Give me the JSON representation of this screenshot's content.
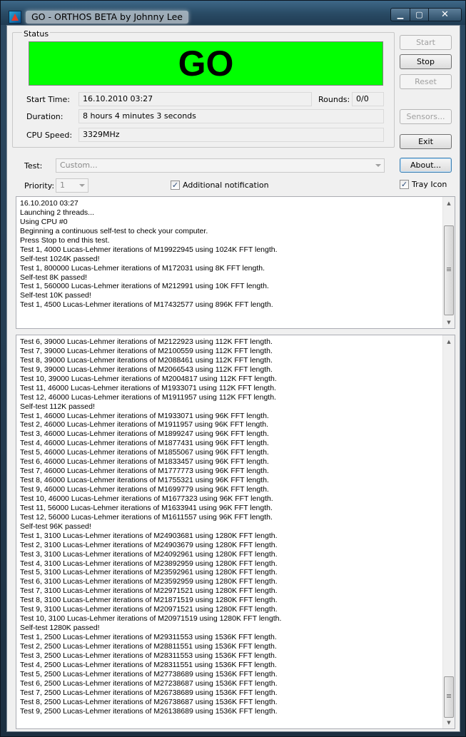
{
  "window": {
    "title": "GO - ORTHOS BETA by Johnny Lee",
    "minimize_glyph": "▁",
    "maximize_glyph": "▢",
    "close_glyph": "✕"
  },
  "status": {
    "legend": "Status",
    "state_text": "GO",
    "state_color": "#00ff00",
    "start_time_label": "Start Time:",
    "start_time_value": "16.10.2010 03:27",
    "rounds_label": "Rounds:",
    "rounds_value": "0/0",
    "duration_label": "Duration:",
    "duration_value": "8 hours 4 minutes 3 seconds",
    "cpu_speed_label": "CPU Speed:",
    "cpu_speed_value": "3329MHz"
  },
  "buttons": {
    "start": "Start",
    "stop": "Stop",
    "reset": "Reset",
    "sensors": "Sensors...",
    "exit": "Exit",
    "about": "About..."
  },
  "options": {
    "test_label": "Test:",
    "test_value": "Custom...",
    "priority_label": "Priority:",
    "priority_value": "1",
    "additional_notification_label": "Additional notification",
    "additional_notification_checked": true,
    "tray_icon_label": "Tray Icon",
    "tray_icon_checked": true,
    "check_glyph": "✓"
  },
  "log_top": {
    "lines": [
      "16.10.2010 03:27",
      "Launching 2 threads...",
      "Using CPU #0",
      "Beginning a continuous self-test to check your computer.",
      "Press Stop to end this test.",
      "Test 1, 4000 Lucas-Lehmer iterations of M19922945 using 1024K FFT length.",
      "Self-test 1024K passed!",
      "Test 1, 800000 Lucas-Lehmer iterations of M172031 using 8K FFT length.",
      "Self-test 8K passed!",
      "Test 1, 560000 Lucas-Lehmer iterations of M212991 using 10K FFT length.",
      "Self-test 10K passed!",
      "Test 1, 4500 Lucas-Lehmer iterations of M17432577 using 896K FFT length."
    ]
  },
  "log_bottom": {
    "lines": [
      "Test 6, 39000 Lucas-Lehmer iterations of M2122923 using 112K FFT length.",
      "Test 7, 39000 Lucas-Lehmer iterations of M2100559 using 112K FFT length.",
      "Test 8, 39000 Lucas-Lehmer iterations of M2088461 using 112K FFT length.",
      "Test 9, 39000 Lucas-Lehmer iterations of M2066543 using 112K FFT length.",
      "Test 10, 39000 Lucas-Lehmer iterations of M2004817 using 112K FFT length.",
      "Test 11, 46000 Lucas-Lehmer iterations of M1933071 using 112K FFT length.",
      "Test 12, 46000 Lucas-Lehmer iterations of M1911957 using 112K FFT length.",
      "Self-test 112K passed!",
      "Test 1, 46000 Lucas-Lehmer iterations of M1933071 using 96K FFT length.",
      "Test 2, 46000 Lucas-Lehmer iterations of M1911957 using 96K FFT length.",
      "Test 3, 46000 Lucas-Lehmer iterations of M1899247 using 96K FFT length.",
      "Test 4, 46000 Lucas-Lehmer iterations of M1877431 using 96K FFT length.",
      "Test 5, 46000 Lucas-Lehmer iterations of M1855067 using 96K FFT length.",
      "Test 6, 46000 Lucas-Lehmer iterations of M1833457 using 96K FFT length.",
      "Test 7, 46000 Lucas-Lehmer iterations of M1777773 using 96K FFT length.",
      "Test 8, 46000 Lucas-Lehmer iterations of M1755321 using 96K FFT length.",
      "Test 9, 46000 Lucas-Lehmer iterations of M1699779 using 96K FFT length.",
      "Test 10, 46000 Lucas-Lehmer iterations of M1677323 using 96K FFT length.",
      "Test 11, 56000 Lucas-Lehmer iterations of M1633941 using 96K FFT length.",
      "Test 12, 56000 Lucas-Lehmer iterations of M1611557 using 96K FFT length.",
      "Self-test 96K passed!",
      "Test 1, 3100 Lucas-Lehmer iterations of M24903681 using 1280K FFT length.",
      "Test 2, 3100 Lucas-Lehmer iterations of M24903679 using 1280K FFT length.",
      "Test 3, 3100 Lucas-Lehmer iterations of M24092961 using 1280K FFT length.",
      "Test 4, 3100 Lucas-Lehmer iterations of M23892959 using 1280K FFT length.",
      "Test 5, 3100 Lucas-Lehmer iterations of M23592961 using 1280K FFT length.",
      "Test 6, 3100 Lucas-Lehmer iterations of M23592959 using 1280K FFT length.",
      "Test 7, 3100 Lucas-Lehmer iterations of M22971521 using 1280K FFT length.",
      "Test 8, 3100 Lucas-Lehmer iterations of M21871519 using 1280K FFT length.",
      "Test 9, 3100 Lucas-Lehmer iterations of M20971521 using 1280K FFT length.",
      "Test 10, 3100 Lucas-Lehmer iterations of M20971519 using 1280K FFT length.",
      "Self-test 1280K passed!",
      "Test 1, 2500 Lucas-Lehmer iterations of M29311553 using 1536K FFT length.",
      "Test 2, 2500 Lucas-Lehmer iterations of M28811551 using 1536K FFT length.",
      "Test 3, 2500 Lucas-Lehmer iterations of M28311553 using 1536K FFT length.",
      "Test 4, 2500 Lucas-Lehmer iterations of M28311551 using 1536K FFT length.",
      "Test 5, 2500 Lucas-Lehmer iterations of M27738689 using 1536K FFT length.",
      "Test 6, 2500 Lucas-Lehmer iterations of M27238687 using 1536K FFT length.",
      "Test 7, 2500 Lucas-Lehmer iterations of M26738689 using 1536K FFT length.",
      "Test 8, 2500 Lucas-Lehmer iterations of M26738687 using 1536K FFT length.",
      "Test 9, 2500 Lucas-Lehmer iterations of M26138689 using 1536K FFT length."
    ]
  }
}
